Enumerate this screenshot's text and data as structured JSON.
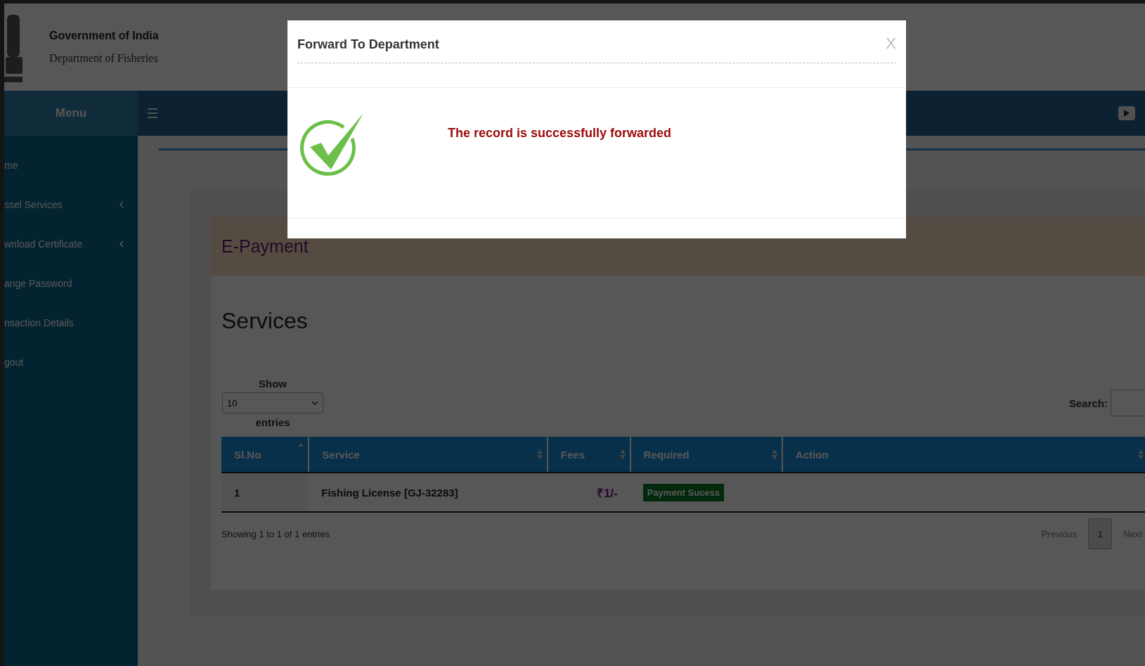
{
  "header": {
    "title": "Government of India",
    "subtitle": "Department of Fisheries"
  },
  "menu_label": "Menu",
  "sidebar": {
    "items": [
      {
        "label": "me",
        "expandable": false
      },
      {
        "label": "ssel Services",
        "expandable": true
      },
      {
        "label": "wnload Certificate",
        "expandable": true
      },
      {
        "label": "ange Password",
        "expandable": false
      },
      {
        "label": "nsaction Details",
        "expandable": false
      },
      {
        "label": "gout",
        "expandable": false
      }
    ]
  },
  "page_title": "E-Payment",
  "section_title": "Services",
  "length_control": {
    "show_label": "Show",
    "value": "10",
    "entries_label": "entries"
  },
  "search": {
    "label": "Search:"
  },
  "table": {
    "columns": [
      {
        "label": "Sl.No",
        "sorted": true
      },
      {
        "label": "Service",
        "sorted": false
      },
      {
        "label": "Fees",
        "sorted": false
      },
      {
        "label": "Required",
        "sorted": false
      },
      {
        "label": "Action",
        "sorted": false
      }
    ],
    "rows": [
      {
        "sl_no": "1",
        "service": "Fishing License [GJ-32283]",
        "fees": "₹1/-",
        "required": "Payment Sucess"
      }
    ]
  },
  "info": "Showing 1 to 1 of 1 entries",
  "pagination": {
    "previous": "Previous",
    "pages": [
      {
        "label": "1",
        "selected": true
      }
    ],
    "next": "Next"
  },
  "modal": {
    "title": "Forward To Department",
    "close": "X",
    "message": "The record is successfully forwarded"
  }
}
